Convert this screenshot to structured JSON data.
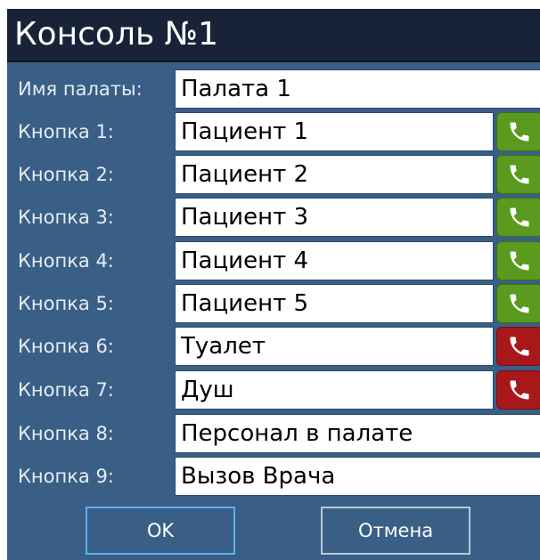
{
  "window": {
    "title": "Консоль №1"
  },
  "form": {
    "room_label": "Имя палаты:",
    "room_value": "Палата 1",
    "rows": [
      {
        "label": "Кнопка 1:",
        "value": "Пациент 1",
        "call_icon": "phone-icon",
        "call_color": "#5a9a1e"
      },
      {
        "label": "Кнопка 2:",
        "value": "Пациент 2",
        "call_icon": "phone-icon",
        "call_color": "#5a9a1e"
      },
      {
        "label": "Кнопка 3:",
        "value": "Пациент 3",
        "call_icon": "phone-icon",
        "call_color": "#5a9a1e"
      },
      {
        "label": "Кнопка 4:",
        "value": "Пациент 4",
        "call_icon": "phone-icon",
        "call_color": "#5a9a1e"
      },
      {
        "label": "Кнопка 5:",
        "value": "Пациент 5",
        "call_icon": "phone-icon",
        "call_color": "#5a9a1e"
      },
      {
        "label": "Кнопка 6:",
        "value": "Туалет",
        "call_icon": "phone-icon",
        "call_color": "#a8181a"
      },
      {
        "label": "Кнопка 7:",
        "value": "Душ",
        "call_icon": "phone-icon",
        "call_color": "#a8181a"
      },
      {
        "label": "Кнопка 8:",
        "value": "Персонал в палате"
      },
      {
        "label": "Кнопка 9:",
        "value": "Вызов Врача"
      }
    ]
  },
  "buttons": {
    "ok_label": "OK",
    "cancel_label": "Отмена"
  },
  "colors": {
    "titlebar": "#182337",
    "panel": "#3a5f86",
    "call_green": "#5a9a1e",
    "call_red": "#a8181a",
    "ok_border": "#5fb1ec"
  }
}
